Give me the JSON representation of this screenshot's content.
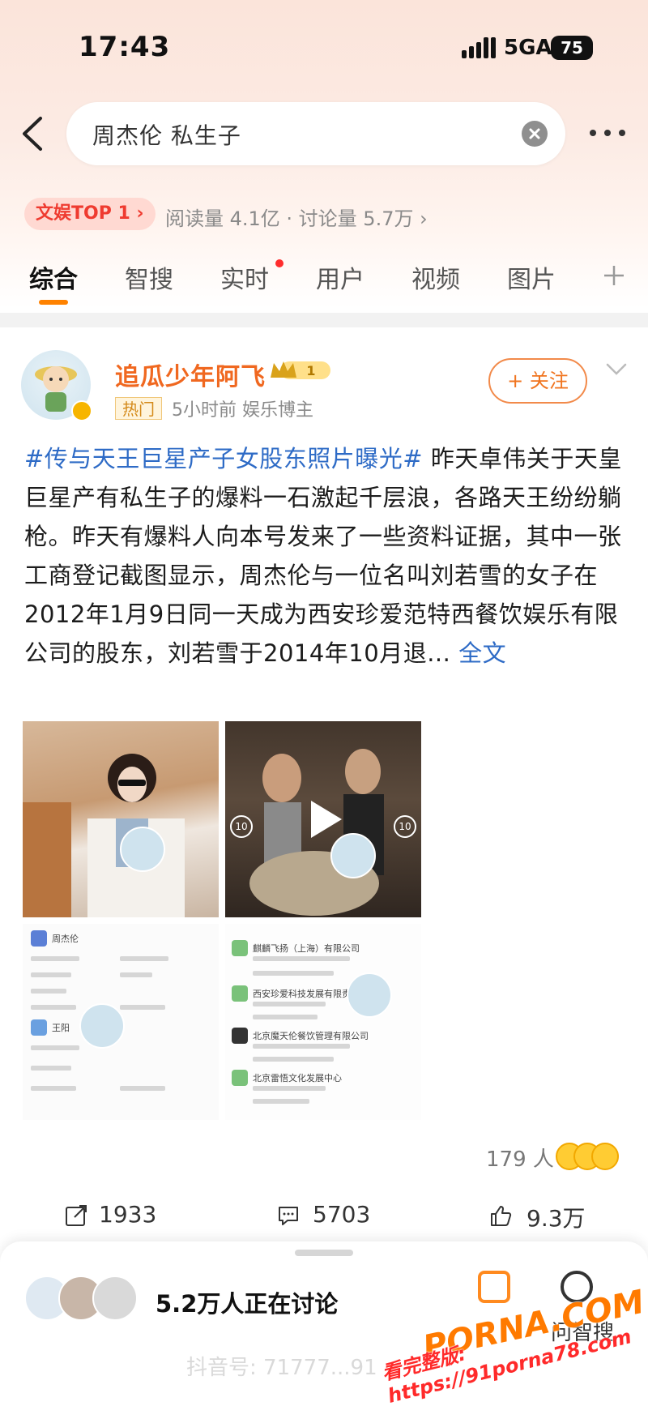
{
  "status_bar": {
    "time": "17:43",
    "network": "5GA",
    "battery": "75"
  },
  "search": {
    "query": "周杰伦 私生子"
  },
  "trend": {
    "badge": "文娱TOP 1 ›",
    "stats": "阅读量 4.1亿 · 讨论量 5.7万 ›"
  },
  "tabs": [
    "综合",
    "智搜",
    "实时",
    "用户",
    "视频",
    "图片"
  ],
  "post": {
    "author": "追瓜少年阿飞",
    "vip_level": "1",
    "hot_tag": "热门",
    "meta": "5小时前  娱乐博主",
    "follow_label": "+ 关注",
    "hashtag": "#传与天王巨星产子女股东照片曝光#",
    "body": " 昨天卓伟关于天皇巨星产有私生子的爆料一石激起千层浪，各路天王纷纷躺枪。昨天有爆料人向本号发来了一些资料证据，其中一张工商登记截图显示，周杰伦与一位名叫刘若雪的女子在2012年1月9日同一天成为西安珍爱范特西餐饮娱乐有限公司的股东，刘若雪于2014年10月退...",
    "fulltext_label": " 全文",
    "video_rewind": "10",
    "video_forward": "10",
    "img3_name1": "周杰伦",
    "img3_name2": "王阳",
    "img4_companies": [
      "麒麟飞扬（上海）有限公司",
      "西安珍爱科技发展有限责任公司",
      "北京魔天伦餐饮管理有限公司",
      "北京雷悟文化发展中心"
    ],
    "reaction_count": "179 人"
  },
  "actions": {
    "share": "1933",
    "comment": "5703",
    "like": "9.3万"
  },
  "bottom_sheet": {
    "discussing": "5.2万人正在讨论",
    "smart_search": "问智搜"
  },
  "overlay": {
    "douyin": "抖音号: 71777...91",
    "watermark_brand": "PORNA.COM",
    "watermark_url": "看完整版: https://91porna78.com"
  }
}
